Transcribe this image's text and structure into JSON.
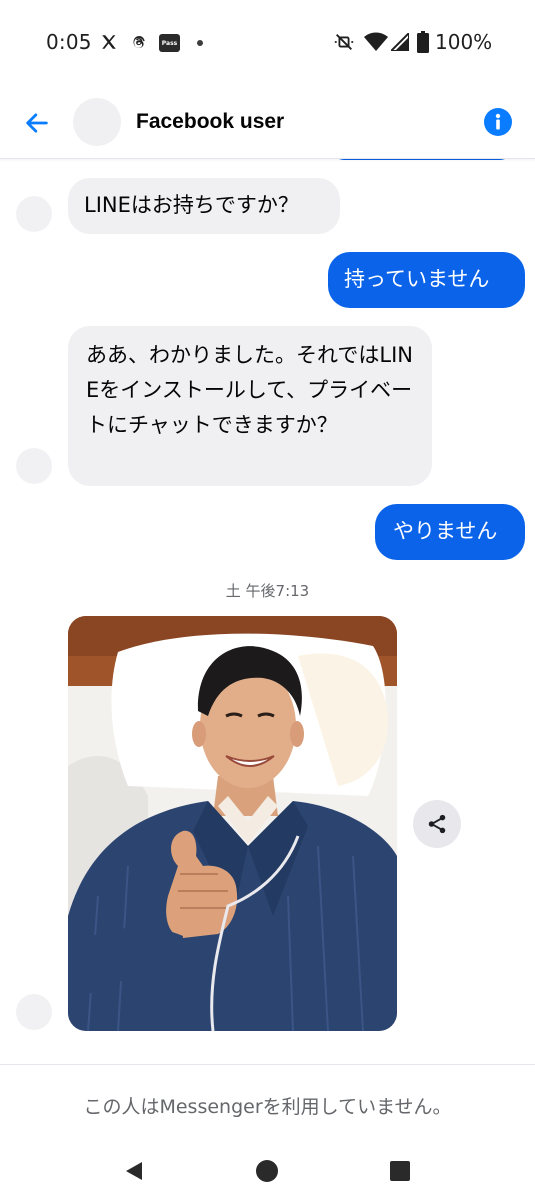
{
  "status_bar": {
    "time": "0:05",
    "battery": "100%",
    "pass_badge": "Pass",
    "icons": [
      "x-icon",
      "threads-icon",
      "pass-icon",
      "notification-dot",
      "mute-icon",
      "wifi-icon",
      "signal-icon",
      "battery-icon"
    ]
  },
  "header": {
    "contact_name": "Facebook user",
    "back_icon": "back-arrow-icon",
    "info_icon": "info-icon",
    "accent_color": "#0a7cff"
  },
  "messages": [
    {
      "direction": "incoming",
      "text": "LINEはお持ちですか？"
    },
    {
      "direction": "outgoing",
      "text": "持っていません"
    },
    {
      "direction": "incoming",
      "text": "ああ、わかりました。それではLINEをインストールして、プライベートにチャットできますか？"
    },
    {
      "direction": "outgoing",
      "text": "やりません"
    }
  ],
  "timestamp": "土 午後7:13",
  "photo": {
    "type": "image",
    "subject": "smiling man in blue robe giving thumbs up on bed",
    "share_icon": "share-icon"
  },
  "footer": {
    "notice": "この人はMessengerを利用していません。"
  },
  "nav": {
    "icons": [
      "back-triangle-icon",
      "home-circle-icon",
      "recents-square-icon"
    ]
  },
  "colors": {
    "outgoing_bubble": "#0a63e8",
    "incoming_bubble": "#f0f0f2",
    "secondary_text": "#65676b"
  }
}
